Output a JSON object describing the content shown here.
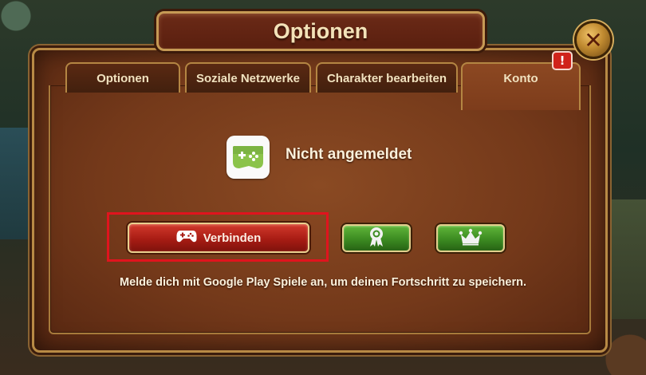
{
  "dialog": {
    "title": "Optionen",
    "close_icon": "close-icon",
    "close_label": "✕"
  },
  "tabs": [
    {
      "label": "Optionen",
      "active": false
    },
    {
      "label": "Soziale Netzwerke",
      "active": false
    },
    {
      "label": "Charakter bearbeiten",
      "active": false
    },
    {
      "label": "Konto",
      "active": true,
      "badge": "!"
    }
  ],
  "account": {
    "icon": "google-play-games-icon",
    "status": "Nicht angemeldet",
    "connect_label": "Verbinden",
    "connect_icon": "gamepad-icon",
    "achievements_icon": "ribbon-award-icon",
    "leaderboard_icon": "crown-icon",
    "hint": "Melde dich mit Google Play Spiele an, um deinen Fortschritt zu speichern."
  },
  "colors": {
    "accent_red": "#c0261a",
    "accent_green": "#3f8f24",
    "panel": "#7a3c1b",
    "highlight": "#e0141e"
  }
}
